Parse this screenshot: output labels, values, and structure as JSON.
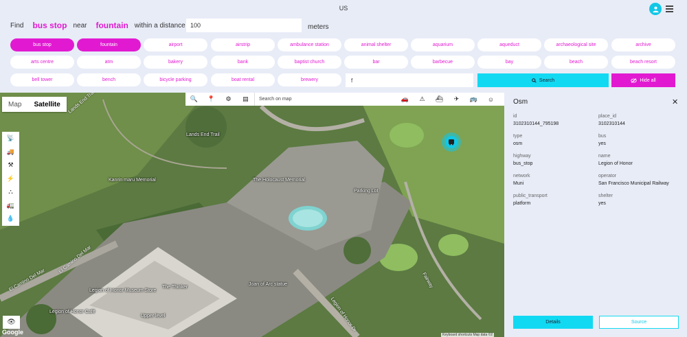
{
  "header": {
    "country": "US",
    "avatar_icon": "user-badge-icon",
    "menu_icon": "hamburger-icon"
  },
  "find": {
    "find_label": "Find",
    "what": "bus stop",
    "near_label": "near",
    "near": "fountain",
    "distance_label": "within a distance of",
    "distance_value": "100",
    "unit_label": "meters"
  },
  "chips": [
    {
      "label": "bus stop",
      "active": true
    },
    {
      "label": "fountain",
      "active": true
    },
    {
      "label": "airport",
      "active": false
    },
    {
      "label": "airstrip",
      "active": false
    },
    {
      "label": "ambulance station",
      "active": false
    },
    {
      "label": "animal shelter",
      "active": false
    },
    {
      "label": "aquarium",
      "active": false
    },
    {
      "label": "aqueduct",
      "active": false
    },
    {
      "label": "archaeological site",
      "active": false
    },
    {
      "label": "archive",
      "active": false
    },
    {
      "label": "arts centre",
      "active": false
    },
    {
      "label": "atm",
      "active": false
    },
    {
      "label": "bakery",
      "active": false
    },
    {
      "label": "bank",
      "active": false
    },
    {
      "label": "baptist church",
      "active": false
    },
    {
      "label": "bar",
      "active": false
    },
    {
      "label": "barbecue",
      "active": false
    },
    {
      "label": "bay",
      "active": false
    },
    {
      "label": "beach",
      "active": false
    },
    {
      "label": "beach resort",
      "active": false
    },
    {
      "label": "bell tower",
      "active": false
    },
    {
      "label": "bench",
      "active": false
    },
    {
      "label": "bicycle parking",
      "active": false
    },
    {
      "label": "boat rental",
      "active": false
    },
    {
      "label": "brewery",
      "active": false
    }
  ],
  "filter": {
    "value": "f"
  },
  "actions": {
    "search_label": "Search",
    "hide_label": "Hide all"
  },
  "map": {
    "type_map": "Map",
    "type_satellite": "Satellite",
    "search_placeholder": "Search on map",
    "google": "Google",
    "attribution": "Keyboard shortcuts   Map data ©2",
    "places": [
      "Lands End Trail",
      "Lands End Trail",
      "Kanrin maru Memorial",
      "The Holocaust Memorial",
      "Parking Lot",
      "Legion of Honor Museum Store",
      "The Thinker",
      "Joan of Arc statue",
      "Legion of Honor Café",
      "Upper level",
      "El Camino Del Mar",
      "El Camino Del Mar",
      "Legion of Honor Dr",
      "Fairway"
    ]
  },
  "panel": {
    "title": "Osm",
    "props": [
      {
        "key": "id",
        "value": "3102310144_795198"
      },
      {
        "key": "place_id",
        "value": "3102310144"
      },
      {
        "key": "type",
        "value": "osm"
      },
      {
        "key": "bus",
        "value": "yes"
      },
      {
        "key": "highway",
        "value": "bus_stop"
      },
      {
        "key": "name",
        "value": "Legion of Honor"
      },
      {
        "key": "network",
        "value": "Muni"
      },
      {
        "key": "operator",
        "value": "San Francisco Municipal Railway"
      },
      {
        "key": "public_transport",
        "value": "platform"
      },
      {
        "key": "shelter",
        "value": "yes"
      }
    ],
    "details_label": "Details",
    "source_label": "Source"
  },
  "colors": {
    "accent_magenta": "#e11ad1",
    "accent_cyan": "#12d9f2",
    "background": "#e8ecf7"
  }
}
